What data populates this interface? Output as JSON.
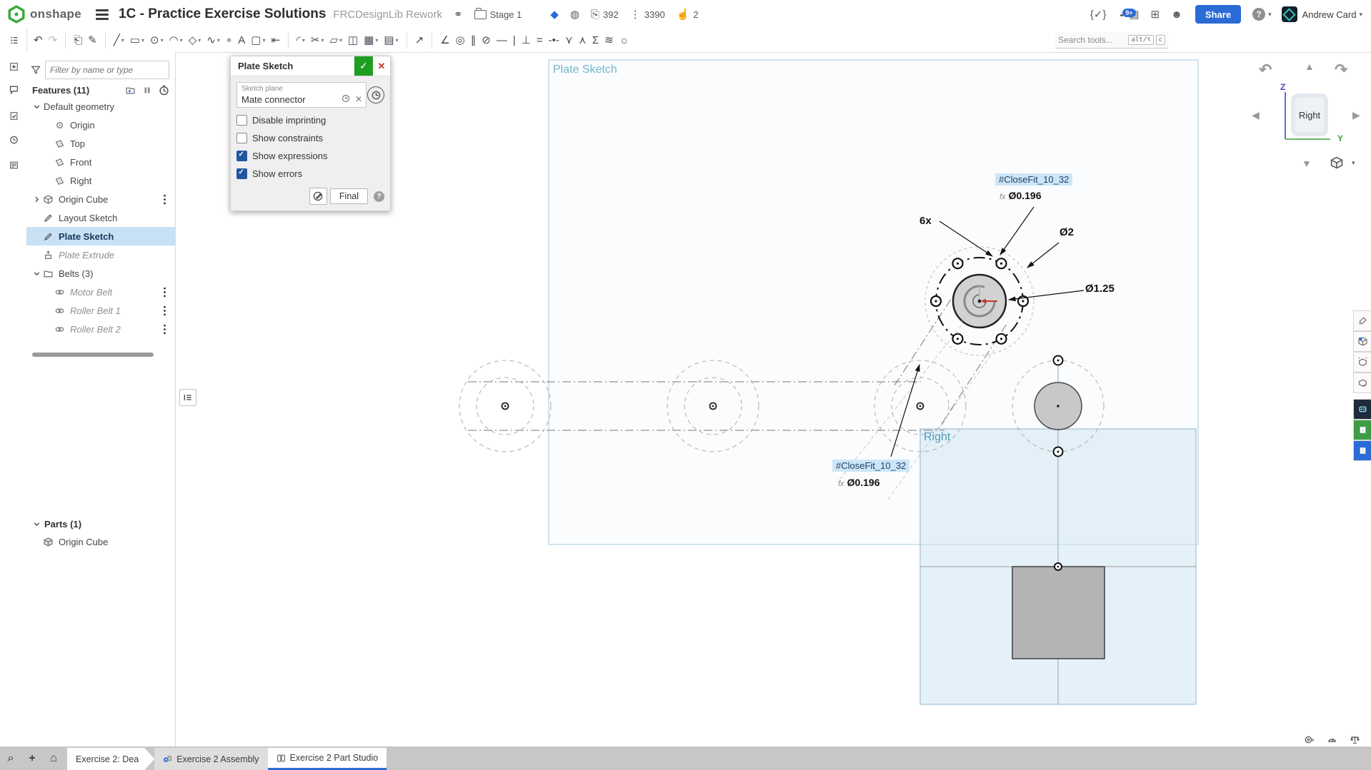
{
  "topbar": {
    "logo_text": "onshape",
    "title": "1C - Practice Exercise Solutions",
    "subtitle": "FRCDesignLib Rework",
    "folder_label": "Stage 1",
    "copies_count": "392",
    "version_count": "3390",
    "likes_count": "2",
    "notification_badge": "9+",
    "share_label": "Share",
    "help_label": "?",
    "user_name": "Andrew Card",
    "brand_green": "#3aaa3f",
    "accent_blue": "#2a6bd6"
  },
  "toolbar": {
    "search_placeholder": "Search tools...",
    "kbd1": "alt/⌥",
    "kbd2": "c",
    "tools": [
      {
        "name": "sketch-line-tool",
        "glyph": "╱",
        "dd": true
      },
      {
        "name": "sketch-rectangle-tool",
        "glyph": "▭",
        "dd": true
      },
      {
        "name": "sketch-circle-tool",
        "glyph": "⊙",
        "dd": true
      },
      {
        "name": "sketch-arc-tool",
        "glyph": "◠",
        "dd": true
      },
      {
        "name": "sketch-polygon-tool",
        "glyph": "◇",
        "dd": true
      },
      {
        "name": "sketch-spline-tool",
        "glyph": "∿",
        "dd": true
      },
      {
        "name": "sketch-point-tool",
        "glyph": "∘",
        "dd": false
      },
      {
        "name": "sketch-text-tool",
        "glyph": "A",
        "dd": false
      },
      {
        "name": "sketch-slot-tool",
        "glyph": "▢",
        "dd": true
      },
      {
        "name": "sketch-centerline-tool",
        "glyph": "⇤",
        "dd": false,
        "sep": true
      },
      {
        "name": "sketch-fillet-tool",
        "glyph": "◜",
        "dd": true
      },
      {
        "name": "sketch-trim-tool",
        "glyph": "✂",
        "dd": true
      },
      {
        "name": "sketch-offset-tool",
        "glyph": "▱",
        "dd": true
      },
      {
        "name": "sketch-mirror-tool",
        "glyph": "◫",
        "dd": false
      },
      {
        "name": "sketch-pattern-tool",
        "glyph": "▦",
        "dd": true
      },
      {
        "name": "insert-dxf-tool",
        "glyph": "▤",
        "dd": true,
        "sep": true
      },
      {
        "name": "dimension-tool",
        "glyph": "↗",
        "dd": false,
        "sep": true
      },
      {
        "name": "coincident-constraint",
        "glyph": "∠",
        "dd": false
      },
      {
        "name": "concentric-constraint",
        "glyph": "◎",
        "dd": false
      },
      {
        "name": "parallel-constraint",
        "glyph": "∥",
        "dd": false
      },
      {
        "name": "tangent-constraint",
        "glyph": "⊘",
        "dd": false
      },
      {
        "name": "horizontal-constraint",
        "glyph": "—",
        "dd": false
      },
      {
        "name": "vertical-constraint",
        "glyph": "|",
        "dd": false
      },
      {
        "name": "perpendicular-constraint",
        "glyph": "⊥",
        "dd": false
      },
      {
        "name": "equal-constraint",
        "glyph": "=",
        "dd": false
      },
      {
        "name": "midpoint-constraint",
        "glyph": "-•-",
        "dd": false
      },
      {
        "name": "normal-constraint",
        "glyph": "⋎",
        "dd": false
      },
      {
        "name": "pierce-constraint",
        "glyph": "⋏",
        "dd": false
      },
      {
        "name": "symmetry-constraint",
        "glyph": "Σ",
        "dd": false
      },
      {
        "name": "curvature-constraint",
        "glyph": "≋",
        "dd": false
      },
      {
        "name": "silhouette-constraint",
        "glyph": "☼",
        "dd": false
      }
    ]
  },
  "left_strip": [
    {
      "name": "feature-list-panel-icon",
      "icon": "listicon"
    },
    {
      "name": "insert-panel-icon",
      "icon": "plusdoc"
    },
    {
      "name": "comments-panel-icon",
      "icon": "comment"
    },
    {
      "name": "tasks-panel-icon",
      "icon": "doccheck"
    },
    {
      "name": "history-panel-icon",
      "icon": "clock"
    },
    {
      "name": "notes-panel-icon",
      "icon": "notes"
    }
  ],
  "feature_panel": {
    "filter_placeholder": "Filter by name or type",
    "features_header": "Features (11)",
    "parts_header": "Parts (1)",
    "tree": [
      {
        "label": "Default geometry",
        "chev": "chevD",
        "icon": "",
        "indent": 0,
        "sel": false,
        "ital": false,
        "dots": false
      },
      {
        "label": "Origin",
        "chev": "",
        "icon": "origin",
        "indent": 1,
        "sel": false,
        "ital": false,
        "dots": false
      },
      {
        "label": "Top",
        "chev": "",
        "icon": "plane",
        "indent": 1,
        "sel": false,
        "ital": false,
        "dots": false
      },
      {
        "label": "Front",
        "chev": "",
        "icon": "plane",
        "indent": 1,
        "sel": false,
        "ital": false,
        "dots": false
      },
      {
        "label": "Right",
        "chev": "",
        "icon": "plane",
        "indent": 1,
        "sel": false,
        "ital": false,
        "dots": false
      },
      {
        "label": "Origin Cube",
        "chev": "chevR",
        "icon": "cube",
        "indent": 0,
        "sel": false,
        "ital": false,
        "dots": true
      },
      {
        "label": "Layout Sketch",
        "chev": "",
        "icon": "sketch",
        "indent": 0,
        "sel": false,
        "ital": false,
        "dots": false
      },
      {
        "label": "Plate Sketch",
        "chev": "",
        "icon": "sketch",
        "indent": 0,
        "sel": true,
        "ital": false,
        "dots": false
      },
      {
        "label": "Plate Extrude",
        "chev": "",
        "icon": "extrude",
        "indent": 0,
        "sel": false,
        "ital": true,
        "dots": false
      },
      {
        "label": "Belts (3)",
        "chev": "chevD",
        "icon": "folder",
        "indent": 0,
        "sel": false,
        "ital": false,
        "dots": false
      },
      {
        "label": "Motor Belt",
        "chev": "",
        "icon": "belt",
        "indent": 1,
        "sel": false,
        "ital": true,
        "dots": true
      },
      {
        "label": "Roller Belt 1",
        "chev": "",
        "icon": "belt",
        "indent": 1,
        "sel": false,
        "ital": true,
        "dots": true
      },
      {
        "label": "Roller Belt 2",
        "chev": "",
        "icon": "belt",
        "indent": 1,
        "sel": false,
        "ital": true,
        "dots": true
      }
    ],
    "parts": [
      {
        "label": "Origin Cube",
        "icon": "part"
      }
    ]
  },
  "dialog": {
    "title": "Plate Sketch",
    "field_label": "Sketch plane",
    "field_value": "Mate connector",
    "checkboxes": [
      {
        "label": "Disable imprinting",
        "checked": false
      },
      {
        "label": "Show constraints",
        "checked": false
      },
      {
        "label": "Show expressions",
        "checked": true
      },
      {
        "label": "Show errors",
        "checked": true
      }
    ],
    "final_label": "Final",
    "ok_glyph": "✓",
    "close_glyph": "✕"
  },
  "canvas": {
    "plane1_label": "Plate Sketch",
    "plane2_label": "Right",
    "closefit1": "#CloseFit_10_32",
    "dia1": "Ø0.196",
    "fx": "fx",
    "count_note": "6x",
    "dia2": "Ø2",
    "dia3": "Ø1.25",
    "closefit2": "#CloseFit_10_32",
    "dia4": "Ø0.196",
    "highlight_bg": "#cde5f6",
    "plane_teal": "#74b6cb"
  },
  "view_widget": {
    "face_label": "Right",
    "z_label": "Z",
    "y_label": "Y"
  },
  "right_tabs": [
    {
      "name": "appearance-panel-tab",
      "kind": "plain",
      "icon": "paint"
    },
    {
      "name": "sheet-metal-panel-tab",
      "kind": "plain",
      "icon": "cubeS"
    },
    {
      "name": "section-view-panel-tab",
      "kind": "plain",
      "icon": "cubeR"
    },
    {
      "name": "configurations-panel-tab",
      "kind": "plain",
      "icon": "cubeF"
    },
    {
      "name": "ai-advisor-panel-tab",
      "kind": "dark",
      "icon": "robot"
    },
    {
      "name": "learning-panel-tab",
      "kind": "green",
      "icon": "book"
    },
    {
      "name": "docs-panel-tab",
      "kind": "blue",
      "icon": "book"
    }
  ],
  "bottom_utils": [
    {
      "name": "measure-tool-icon",
      "icon": "tape"
    },
    {
      "name": "performance-gauge-icon",
      "icon": "gauge"
    },
    {
      "name": "mass-properties-icon",
      "icon": "scale"
    }
  ],
  "bottom_bar": {
    "search_glyph": "⌕",
    "add_tab_glyph": "+",
    "home_glyph": "⌂",
    "tabs": [
      {
        "label": "Exercise 2: Dea",
        "kind": "pennant",
        "icon": "",
        "active": false
      },
      {
        "label": "Exercise 2 Assembly",
        "kind": "plain",
        "icon": "assembly",
        "active": false
      },
      {
        "label": "Exercise 2 Part Studio",
        "kind": "plain",
        "icon": "partstudio",
        "active": true
      }
    ]
  }
}
